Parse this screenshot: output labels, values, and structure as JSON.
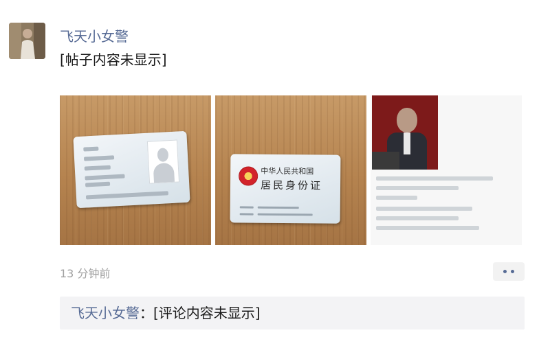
{
  "post": {
    "author": "飞天小女警",
    "text": "[帖子内容未显示]",
    "timestamp": "13 分钟前"
  },
  "images": [
    {
      "kind": "id-card-front",
      "redacted": true
    },
    {
      "kind": "id-card-back",
      "title1": "中华人民共和国",
      "title2": "居民身份证"
    },
    {
      "kind": "profile",
      "redacted": true
    }
  ],
  "comments": [
    {
      "user": "飞天小女警",
      "separator": "：",
      "text": "[评论内容未显示]"
    }
  ],
  "colors": {
    "link_blue": "#576b95",
    "timestamp_gray": "#a0a0a0",
    "comment_bg": "#f3f3f5"
  }
}
